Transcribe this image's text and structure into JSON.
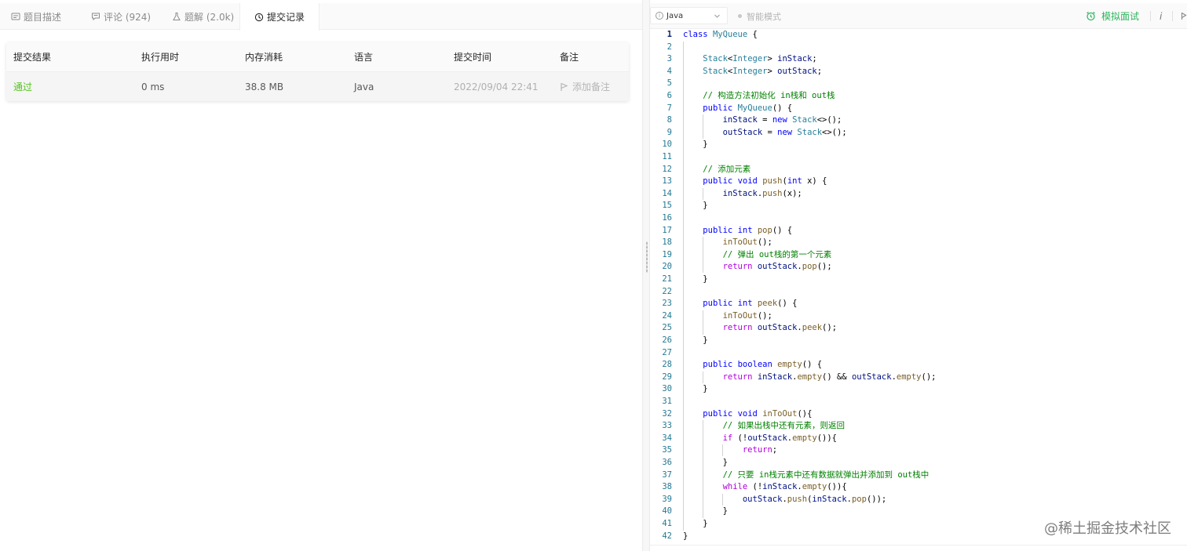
{
  "tabs": [
    {
      "label": "题目描述",
      "icon": "description-icon"
    },
    {
      "label": "评论 (924)",
      "icon": "comment-icon"
    },
    {
      "label": "题解 (2.0k)",
      "icon": "flask-icon"
    },
    {
      "label": "提交记录",
      "icon": "clock-icon",
      "active": true
    }
  ],
  "submissions": {
    "headers": [
      "提交结果",
      "执行用时",
      "内存消耗",
      "语言",
      "提交时间",
      "备注"
    ],
    "rows": [
      {
        "result": "通过",
        "runtime": "0 ms",
        "memory": "38.8 MB",
        "language": "Java",
        "time": "2022/09/04 22:41",
        "note_label": "添加备注"
      }
    ],
    "success_color": "#52c41a"
  },
  "editor_toolbar": {
    "language": "Java",
    "smart_mode": "智能模式",
    "mock_interview": "模拟面试",
    "accent": "#2db55d"
  },
  "code_lines": [
    "class MyQueue {",
    "",
    "    Stack<Integer> inStack;",
    "    Stack<Integer> outStack;",
    "",
    "    // 构造方法初始化 in栈和 out栈",
    "    public MyQueue() {",
    "        inStack = new Stack<>();",
    "        outStack = new Stack<>();",
    "    }",
    "",
    "    // 添加元素",
    "    public void push(int x) {",
    "        inStack.push(x);",
    "    }",
    "",
    "    public int pop() {",
    "        inToOut();",
    "        // 弹出 out栈的第一个元素",
    "        return outStack.pop();",
    "    }",
    "",
    "    public int peek() {",
    "        inToOut();",
    "        return outStack.peek();",
    "    }",
    "",
    "    public boolean empty() {",
    "        return inStack.empty() && outStack.empty();",
    "    }",
    "",
    "    public void inToOut(){",
    "        // 如果出栈中还有元素，则返回",
    "        if (!outStack.empty()){",
    "            return;",
    "        }",
    "        // 只要 in栈元素中还有数据就弹出并添加到 out栈中",
    "        while (!inStack.empty()){",
    "            outStack.push(inStack.pop());",
    "        }",
    "    }",
    "}"
  ],
  "watermark": "@稀土掘金技术社区"
}
